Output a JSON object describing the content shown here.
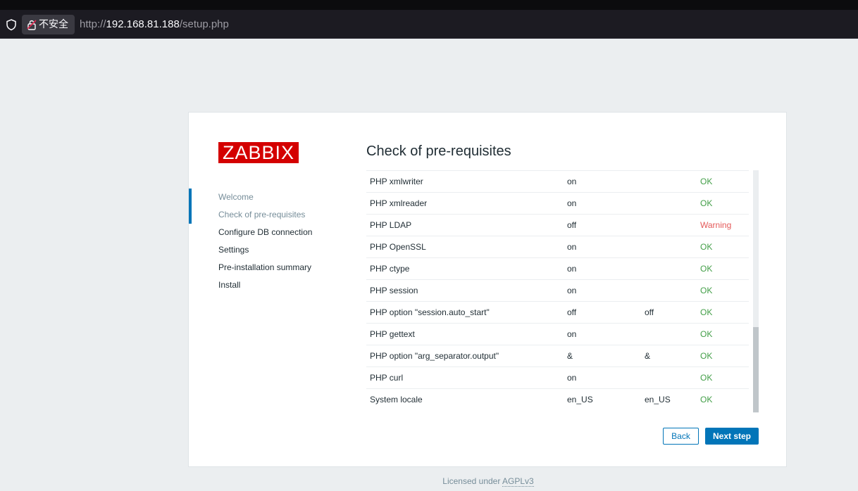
{
  "browser": {
    "insecure_label": "不安全",
    "url_scheme": "http://",
    "url_host": "192.168.81.188",
    "url_path": "/setup.php"
  },
  "logo_text": "ZABBIX",
  "steps": [
    {
      "label": "Welcome"
    },
    {
      "label": "Check of pre-requisites"
    },
    {
      "label": "Configure DB connection"
    },
    {
      "label": "Settings"
    },
    {
      "label": "Pre-installation summary"
    },
    {
      "label": "Install"
    }
  ],
  "page_title": "Check of pre-requisites",
  "rows": [
    {
      "name": "PHP xmlwriter",
      "current": "on",
      "required": "",
      "status": "OK"
    },
    {
      "name": "PHP xmlreader",
      "current": "on",
      "required": "",
      "status": "OK"
    },
    {
      "name": "PHP LDAP",
      "current": "off",
      "required": "",
      "status": "Warning"
    },
    {
      "name": "PHP OpenSSL",
      "current": "on",
      "required": "",
      "status": "OK"
    },
    {
      "name": "PHP ctype",
      "current": "on",
      "required": "",
      "status": "OK"
    },
    {
      "name": "PHP session",
      "current": "on",
      "required": "",
      "status": "OK"
    },
    {
      "name": "PHP option \"session.auto_start\"",
      "current": "off",
      "required": "off",
      "status": "OK"
    },
    {
      "name": "PHP gettext",
      "current": "on",
      "required": "",
      "status": "OK"
    },
    {
      "name": "PHP option \"arg_separator.output\"",
      "current": "&",
      "required": "&",
      "status": "OK"
    },
    {
      "name": "PHP curl",
      "current": "on",
      "required": "",
      "status": "OK"
    },
    {
      "name": "System locale",
      "current": "en_US",
      "required": "en_US",
      "status": "OK"
    }
  ],
  "buttons": {
    "back": "Back",
    "next": "Next step"
  },
  "footer": {
    "prefix": "Licensed under ",
    "link": "AGPLv3"
  },
  "colors": {
    "ok": "#429e47",
    "warning": "#e45959",
    "accent": "#0275b8",
    "logo_bg": "#d40000"
  }
}
